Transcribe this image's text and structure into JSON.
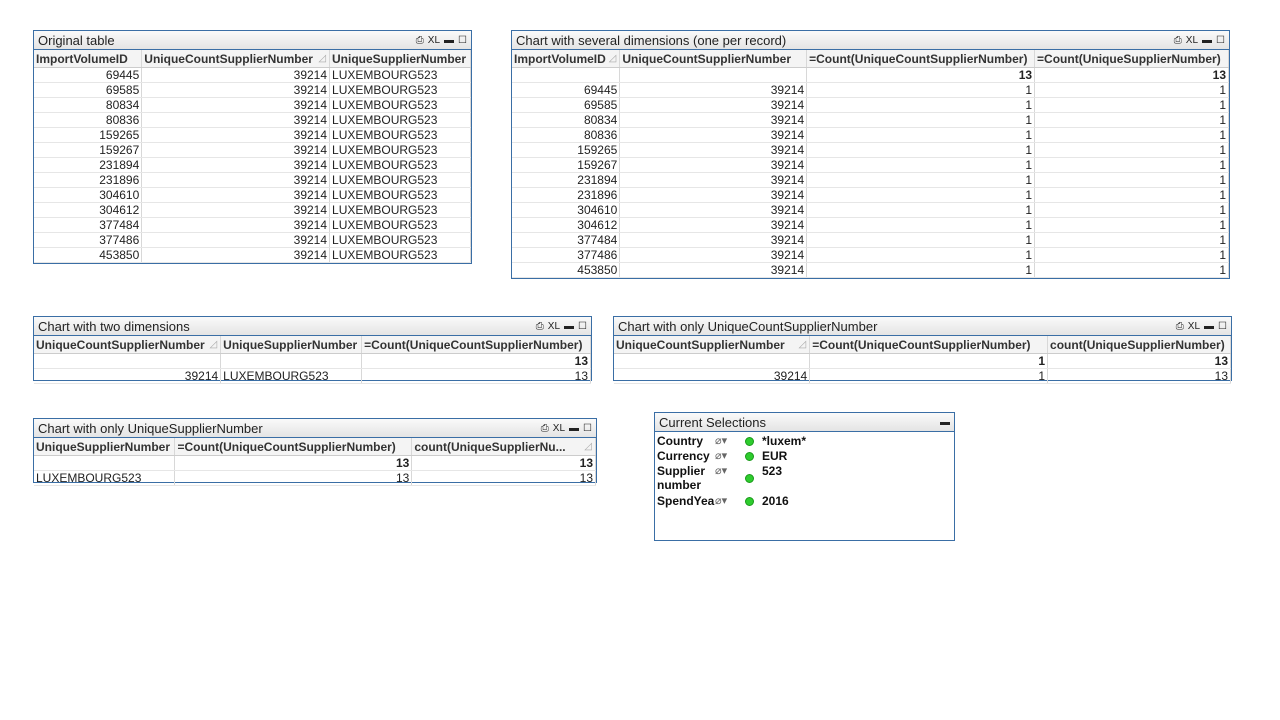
{
  "tables": [
    {
      "id": "original",
      "title": "Original table",
      "headers": [
        "ImportVolumeID",
        "UniqueCountSupplierNumber",
        "UniqueSupplierNumber"
      ],
      "sort_col": 1,
      "totals": null,
      "aligns": [
        "n",
        "n",
        "l"
      ],
      "rows": [
        [
          "69445",
          "39214",
          "LUXEMBOURG523"
        ],
        [
          "69585",
          "39214",
          "LUXEMBOURG523"
        ],
        [
          "80834",
          "39214",
          "LUXEMBOURG523"
        ],
        [
          "80836",
          "39214",
          "LUXEMBOURG523"
        ],
        [
          "159265",
          "39214",
          "LUXEMBOURG523"
        ],
        [
          "159267",
          "39214",
          "LUXEMBOURG523"
        ],
        [
          "231894",
          "39214",
          "LUXEMBOURG523"
        ],
        [
          "231896",
          "39214",
          "LUXEMBOURG523"
        ],
        [
          "304610",
          "39214",
          "LUXEMBOURG523"
        ],
        [
          "304612",
          "39214",
          "LUXEMBOURG523"
        ],
        [
          "377484",
          "39214",
          "LUXEMBOURG523"
        ],
        [
          "377486",
          "39214",
          "LUXEMBOURG523"
        ],
        [
          "453850",
          "39214",
          "LUXEMBOURG523"
        ]
      ]
    },
    {
      "id": "several",
      "title": "Chart with several dimensions (one per record)",
      "headers": [
        "ImportVolumeID",
        "UniqueCountSupplierNumber",
        "=Count(UniqueCountSupplierNumber)",
        "=Count(UniqueSupplierNumber)"
      ],
      "sort_col": 0,
      "totals": [
        "",
        "",
        "13",
        "13"
      ],
      "aligns": [
        "n",
        "n",
        "n",
        "n"
      ],
      "rows": [
        [
          "69445",
          "39214",
          "1",
          "1"
        ],
        [
          "69585",
          "39214",
          "1",
          "1"
        ],
        [
          "80834",
          "39214",
          "1",
          "1"
        ],
        [
          "80836",
          "39214",
          "1",
          "1"
        ],
        [
          "159265",
          "39214",
          "1",
          "1"
        ],
        [
          "159267",
          "39214",
          "1",
          "1"
        ],
        [
          "231894",
          "39214",
          "1",
          "1"
        ],
        [
          "231896",
          "39214",
          "1",
          "1"
        ],
        [
          "304610",
          "39214",
          "1",
          "1"
        ],
        [
          "304612",
          "39214",
          "1",
          "1"
        ],
        [
          "377484",
          "39214",
          "1",
          "1"
        ],
        [
          "377486",
          "39214",
          "1",
          "1"
        ],
        [
          "453850",
          "39214",
          "1",
          "1"
        ]
      ]
    },
    {
      "id": "two-dims",
      "title": "Chart with two dimensions",
      "headers": [
        "UniqueCountSupplierNumber",
        "UniqueSupplierNumber",
        "=Count(UniqueCountSupplierNumber)"
      ],
      "sort_col": 0,
      "totals": [
        "",
        "",
        "13"
      ],
      "aligns": [
        "n",
        "l",
        "n"
      ],
      "rows": [
        [
          "39214",
          "LUXEMBOURG523",
          "13"
        ]
      ]
    },
    {
      "id": "only-ucsn",
      "title": "Chart with only UniqueCountSupplierNumber",
      "headers": [
        "UniqueCountSupplierNumber",
        "=Count(UniqueCountSupplierNumber)",
        "count(UniqueSupplierNumber)"
      ],
      "sort_col": 0,
      "totals": [
        "",
        "1",
        "13"
      ],
      "aligns": [
        "n",
        "n",
        "n"
      ],
      "rows": [
        [
          "39214",
          "1",
          "13"
        ]
      ]
    },
    {
      "id": "only-usn",
      "title": "Chart with only UniqueSupplierNumber",
      "headers": [
        "UniqueSupplierNumber",
        "=Count(UniqueCountSupplierNumber)",
        "count(UniqueSupplierNu..."
      ],
      "sort_col": 2,
      "totals": [
        "",
        "13",
        "13"
      ],
      "aligns": [
        "l",
        "n",
        "n"
      ],
      "rows": [
        [
          "LUXEMBOURG523",
          "13",
          "13"
        ]
      ]
    }
  ],
  "caption_icons": {
    "print": "⎙",
    "xl": "XL",
    "minimize": "▬",
    "maximize": "☐"
  },
  "current_selections": {
    "title": "Current Selections",
    "minimize": "▬",
    "items": [
      {
        "field": "Country",
        "value": "*luxem*"
      },
      {
        "field": "Currency",
        "value": "EUR"
      },
      {
        "field": "Supplier number",
        "value": "523"
      },
      {
        "field": "SpendYea",
        "value": "2016"
      }
    ]
  },
  "colors": {
    "border": "#3a6ea5",
    "selected_dot": "#2ecc2e"
  }
}
